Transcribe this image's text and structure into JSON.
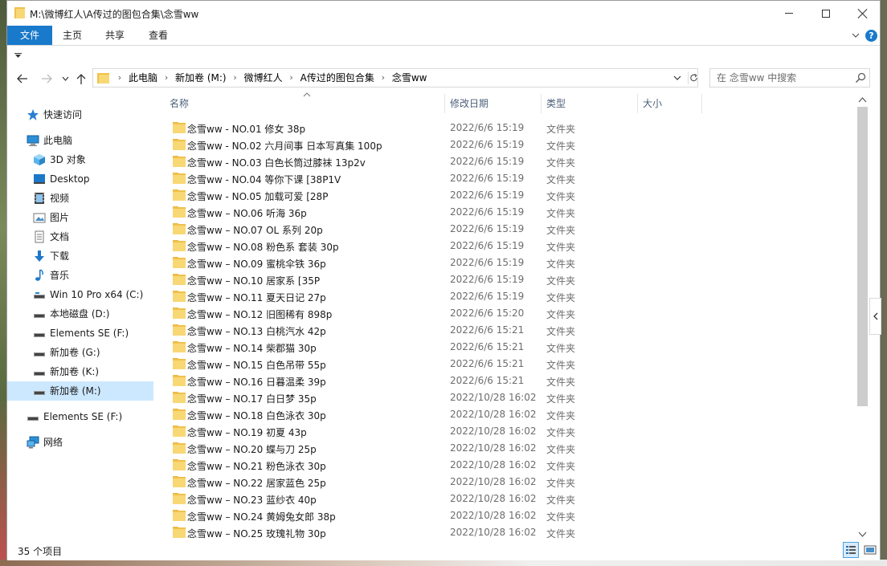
{
  "window": {
    "title": "M:\\微博红人\\A传过的图包合集\\念雪ww"
  },
  "ribbon": {
    "tabs": [
      "文件",
      "主页",
      "共享",
      "查看"
    ],
    "help_label": "?"
  },
  "address": {
    "crumbs": [
      "此电脑",
      "新加卷 (M:)",
      "微博红人",
      "A传过的图包合集",
      "念雪ww"
    ],
    "separator": "›"
  },
  "search": {
    "placeholder": "在 念雪ww 中搜索"
  },
  "sidebar": {
    "items": [
      {
        "label": "快速访问",
        "icon": "star-icon"
      },
      {
        "label": "此电脑",
        "icon": "computer-icon"
      },
      {
        "label": "3D 对象",
        "icon": "3d-objects-icon"
      },
      {
        "label": "Desktop",
        "icon": "desktop-icon"
      },
      {
        "label": "视频",
        "icon": "video-icon"
      },
      {
        "label": "图片",
        "icon": "pictures-icon"
      },
      {
        "label": "文档",
        "icon": "documents-icon"
      },
      {
        "label": "下载",
        "icon": "download-icon"
      },
      {
        "label": "音乐",
        "icon": "music-icon"
      },
      {
        "label": "Win 10 Pro x64 (C:)",
        "icon": "drive-icon"
      },
      {
        "label": "本地磁盘 (D:)",
        "icon": "drive-icon"
      },
      {
        "label": "Elements SE (F:)",
        "icon": "drive-icon"
      },
      {
        "label": "新加卷 (G:)",
        "icon": "drive-icon"
      },
      {
        "label": "新加卷 (K:)",
        "icon": "drive-icon"
      },
      {
        "label": "新加卷 (M:)",
        "icon": "drive-icon"
      },
      {
        "label": "Elements SE (F:)",
        "icon": "drive-icon"
      },
      {
        "label": "网络",
        "icon": "network-icon"
      }
    ],
    "selected": "新加卷 (M:)"
  },
  "columns": {
    "name": "名称",
    "date": "修改日期",
    "type": "类型",
    "size": "大小"
  },
  "files": [
    {
      "name": "念雪ww - NO.01 修女 38p",
      "date": "2022/6/6 15:19",
      "type": "文件夹"
    },
    {
      "name": "念雪ww - NO.02 六月间事 日本写真集 100p",
      "date": "2022/6/6 15:19",
      "type": "文件夹"
    },
    {
      "name": "念雪ww - NO.03 白色长筒过膝袜 13p2v",
      "date": "2022/6/6 15:19",
      "type": "文件夹"
    },
    {
      "name": "念雪ww - NO.04 等你下课 [38P1V",
      "date": "2022/6/6 15:19",
      "type": "文件夹"
    },
    {
      "name": "念雪ww - NO.05 加载可爱 [28P",
      "date": "2022/6/6 15:19",
      "type": "文件夹"
    },
    {
      "name": "念雪ww – NO.06 听海 36p",
      "date": "2022/6/6 15:19",
      "type": "文件夹"
    },
    {
      "name": "念雪ww – NO.07 OL 系列 20p",
      "date": "2022/6/6 15:19",
      "type": "文件夹"
    },
    {
      "name": "念雪ww – NO.08 粉色系 套装 30p",
      "date": "2022/6/6 15:19",
      "type": "文件夹"
    },
    {
      "name": "念雪ww – NO.09 蜜桃伞铁 36p",
      "date": "2022/6/6 15:19",
      "type": "文件夹"
    },
    {
      "name": "念雪ww – NO.10 居家系 [35P",
      "date": "2022/6/6 15:19",
      "type": "文件夹"
    },
    {
      "name": "念雪ww – NO.11 夏天日记 27p",
      "date": "2022/6/6 15:19",
      "type": "文件夹"
    },
    {
      "name": "念雪ww – NO.12 旧图稀有 898p",
      "date": "2022/6/6 15:20",
      "type": "文件夹"
    },
    {
      "name": "念雪ww – NO.13 白桃汽水 42p",
      "date": "2022/6/6 15:21",
      "type": "文件夹"
    },
    {
      "name": "念雪ww – NO.14 柴郡猫 30p",
      "date": "2022/6/6 15:21",
      "type": "文件夹"
    },
    {
      "name": "念雪ww – NO.15 白色吊带 55p",
      "date": "2022/6/6 15:21",
      "type": "文件夹"
    },
    {
      "name": "念雪ww – NO.16 日暮温柔 39p",
      "date": "2022/6/6 15:21",
      "type": "文件夹"
    },
    {
      "name": "念雪ww – NO.17 白日梦 35p",
      "date": "2022/10/28 16:02",
      "type": "文件夹"
    },
    {
      "name": "念雪ww – NO.18 白色泳衣 30p",
      "date": "2022/10/28 16:02",
      "type": "文件夹"
    },
    {
      "name": "念雪ww – NO.19 初夏 43p",
      "date": "2022/10/28 16:02",
      "type": "文件夹"
    },
    {
      "name": "念雪ww – NO.20 蝶与刀 25p",
      "date": "2022/10/28 16:02",
      "type": "文件夹"
    },
    {
      "name": "念雪ww – NO.21 粉色泳衣 30p",
      "date": "2022/10/28 16:02",
      "type": "文件夹"
    },
    {
      "name": "念雪ww – NO.22 居家蓝色 25p",
      "date": "2022/10/28 16:02",
      "type": "文件夹"
    },
    {
      "name": "念雪ww – NO.23 蓝纱衣 40p",
      "date": "2022/10/28 16:02",
      "type": "文件夹"
    },
    {
      "name": "念雪ww – NO.24 黄姆兔女郎 38p",
      "date": "2022/10/28 16:02",
      "type": "文件夹"
    },
    {
      "name": "念雪ww – NO.25 玫瑰礼物 30p",
      "date": "2022/10/28 16:02",
      "type": "文件夹"
    }
  ],
  "status": {
    "count_text": "35 个项目"
  },
  "colors": {
    "accent": "#1979ca",
    "folder": "#f8d775",
    "selection": "#cce8ff"
  }
}
